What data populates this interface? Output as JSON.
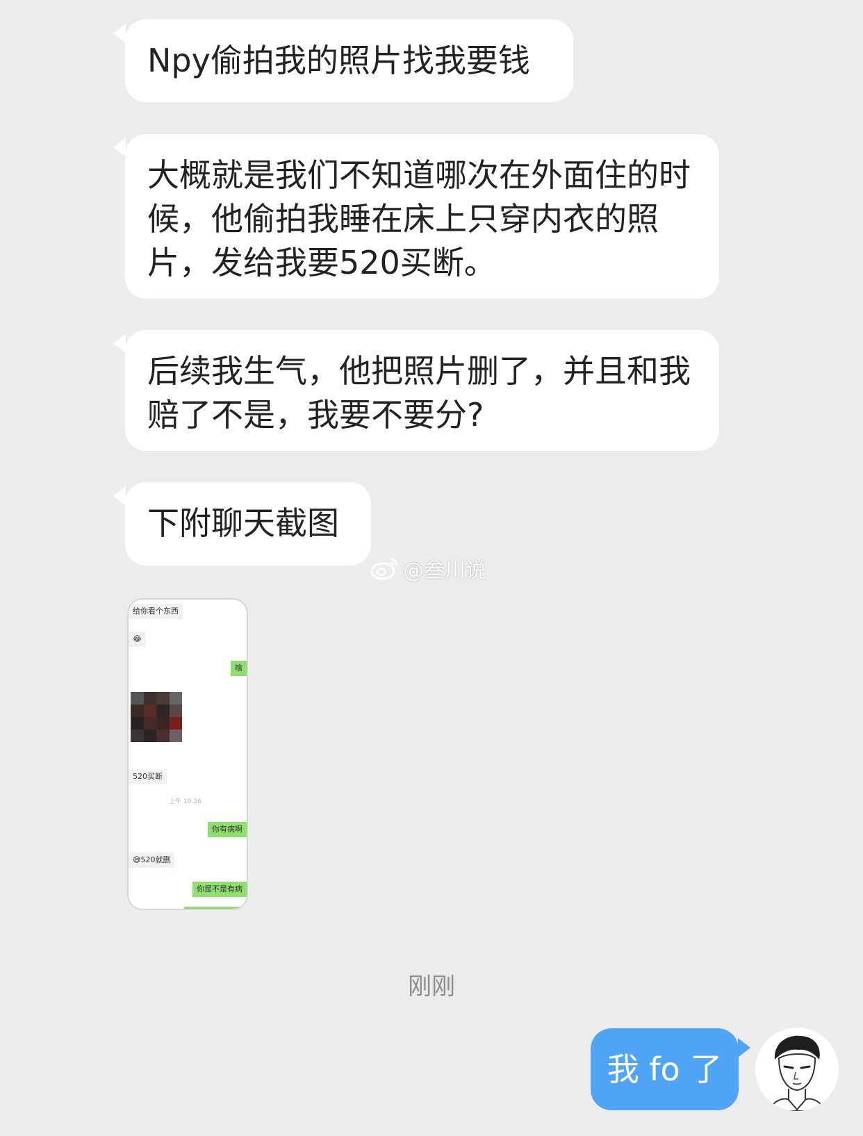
{
  "messages": [
    {
      "text": "Npy偷拍我的照片找我要钱"
    },
    {
      "text": "大概就是我们不知道哪次在外面住的时候，他偷拍我睡在床上只穿内衣的照片，发给我要520买断。"
    },
    {
      "text": "后续我生气，他把照片删了，并且和我赔了不是，我要不要分?"
    },
    {
      "text": "下附聊天截图"
    }
  ],
  "screenshot_thumb": {
    "lines": [
      {
        "text": "给你看个东西"
      },
      {
        "text": "😂"
      },
      {
        "text": "啥"
      },
      {
        "text": "520买断"
      },
      {
        "text": "上午 10:26"
      },
      {
        "text": "你有病啊"
      },
      {
        "text": "😅520就删"
      },
      {
        "text": "你是不是有病"
      }
    ]
  },
  "watermark": {
    "text": "@叁川说"
  },
  "timestamp": "刚刚",
  "reply": {
    "text": "我 fo 了"
  },
  "colors": {
    "background": "#ececec",
    "incoming": "#ffffff",
    "outgoing": "#4fa5f3",
    "mini_green": "#8ee06c"
  }
}
